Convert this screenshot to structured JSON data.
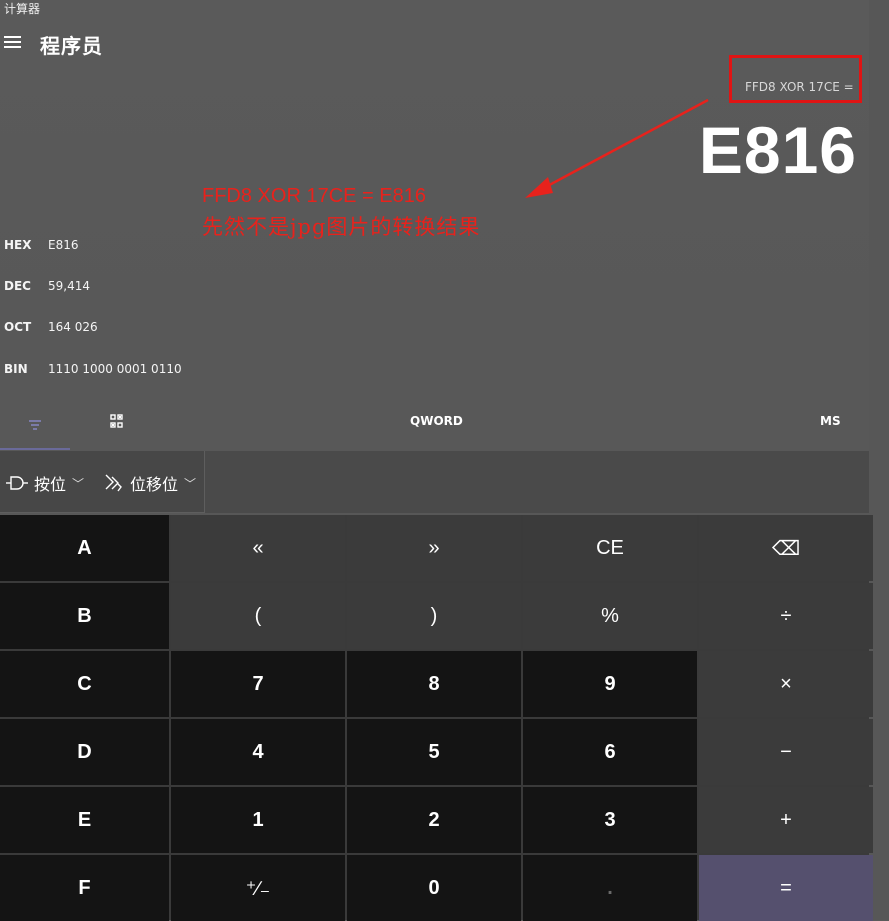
{
  "window": {
    "title": "计算器"
  },
  "header": {
    "mode": "程序员"
  },
  "display": {
    "expression": "FFD8 XOR 17CE =",
    "result": "E816"
  },
  "annotation": {
    "line1": "FFD8 XOR 17CE = E816",
    "line2": "先然不是jpg图片的转换结果",
    "color": "#e8221c"
  },
  "radix": [
    {
      "label": "HEX",
      "value": "E816"
    },
    {
      "label": "DEC",
      "value": "59,414"
    },
    {
      "label": "OCT",
      "value": "164 026"
    },
    {
      "label": "BIN",
      "value": "1110 1000 0001 0110"
    }
  ],
  "tabs": {
    "word_size": "QWORD",
    "memory": "MS"
  },
  "toolbar": {
    "bitwise_label": "按位",
    "bitshift_label": "位移位"
  },
  "keys": {
    "row1": [
      "A",
      "«",
      "»",
      "CE",
      "⌫"
    ],
    "row2": [
      "B",
      "(",
      ")",
      "%",
      "÷"
    ],
    "row3": [
      "C",
      "7",
      "8",
      "9",
      "×"
    ],
    "row4": [
      "D",
      "4",
      "5",
      "6",
      "−"
    ],
    "row5": [
      "E",
      "1",
      "2",
      "3",
      "+"
    ],
    "row6": [
      "F",
      "⁺∕₋",
      "0",
      ".",
      "="
    ]
  },
  "colors": {
    "background": "#575757",
    "digit_key": "#141414",
    "operator_key": "#3b3b3b",
    "equals_key": "#55506e",
    "highlight_box": "#e01414"
  }
}
